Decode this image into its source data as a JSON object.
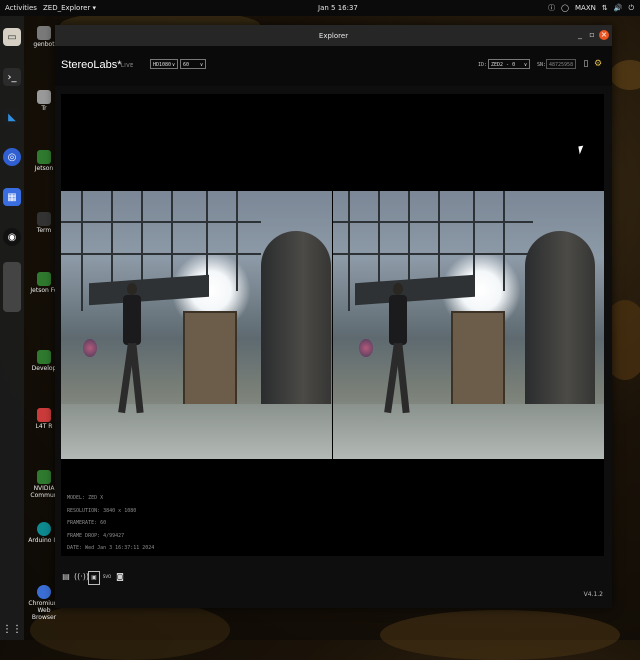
{
  "topbar": {
    "activities": "Activities",
    "app_menu": "ZED_Explorer ▾",
    "clock": "Jan 5 16:37",
    "tray": [
      "ⓘ",
      "◯",
      "MAXN",
      "⇅",
      "🔊",
      "⏻"
    ]
  },
  "desktop_icons": [
    {
      "label": "genbot",
      "color": "#7a7a7a"
    },
    {
      "label": "Tr",
      "color": "#9a9a9a"
    },
    {
      "label": "Jetson",
      "color": "#2f7a2f"
    },
    {
      "label": "Term",
      "color": "#333333"
    },
    {
      "label": "Jetson Fo",
      "color": "#2f7a2f"
    },
    {
      "label": "Develop",
      "color": "#2f7a2f"
    },
    {
      "label": "L4T R",
      "color": "#cc3b3b"
    },
    {
      "label": "NVIDIA Commun",
      "color": "#2f7a2f"
    },
    {
      "label": "Arduino ID",
      "color": "#0e8a91"
    },
    {
      "label": "Chromium Web Browser",
      "color": "#3b6fd6"
    }
  ],
  "window": {
    "title": "Explorer",
    "min": "_",
    "max": "▫",
    "close": "×"
  },
  "header": {
    "logo": "StereoLabs*",
    "live": "LIVE",
    "resolution": "HD1080",
    "fps": "60",
    "id_label": "ID:",
    "id_value": "ZED2 - 0",
    "sn_label": "SN:",
    "sn_value": "48725958",
    "icons": [
      "record-icon",
      "settings-gear-icon"
    ]
  },
  "info": {
    "model": "MODEL: ZED X",
    "resolution": "RESOLUTION: 3840 x 1080",
    "framerate": "FRAMERATE: 60",
    "frame_drop": "FRAME DROP: 4/99427",
    "date": "DATE: Wed Jan 3 16:37:11 2024"
  },
  "footer": {
    "icons": [
      "folder-icon",
      "stream-icon",
      "depth-icon",
      "svo-icon",
      "camera-icon"
    ],
    "svo_label": "SVO",
    "version": "V4.1.2"
  }
}
